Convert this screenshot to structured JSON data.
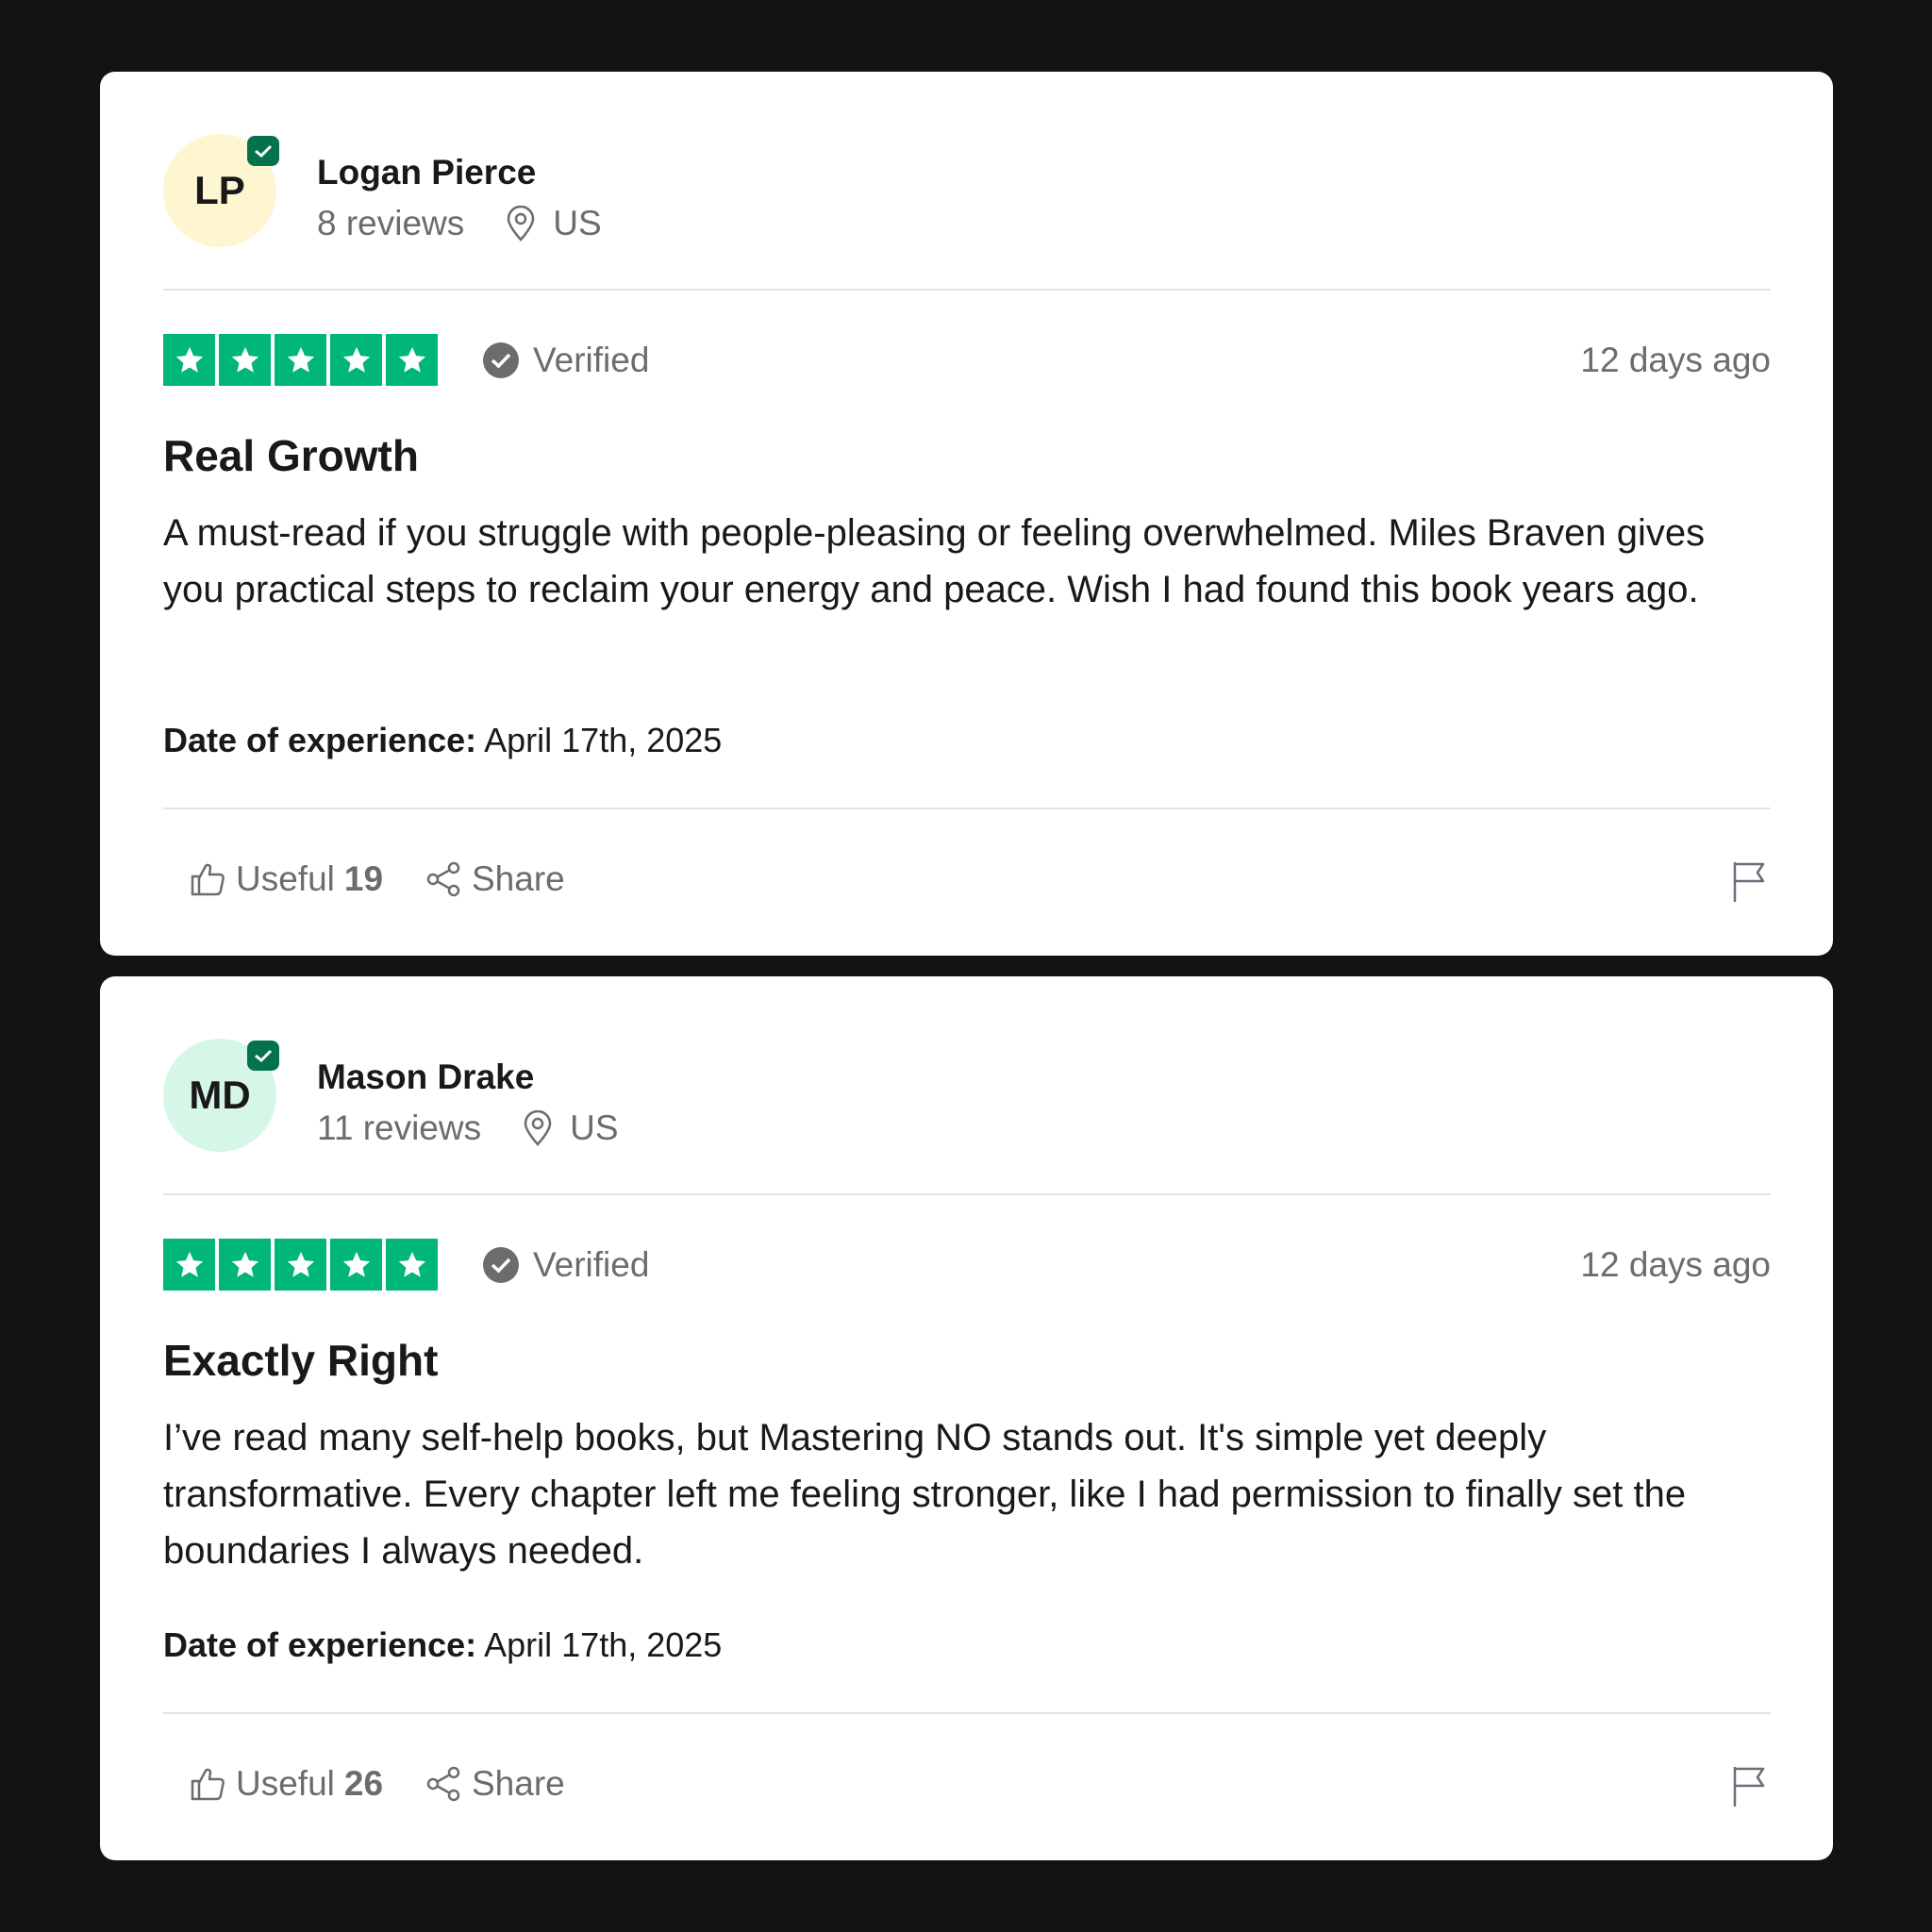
{
  "colors": {
    "background": "#131313",
    "card": "#ffffff",
    "star_green": "#00b67a",
    "badge_green": "#04734d",
    "muted_text": "#6c6c6c"
  },
  "reviews": [
    {
      "avatar": {
        "initials": "LP",
        "bg": "#fdf6d1"
      },
      "reviewer": "Logan Pierce",
      "review_count": "8 reviews",
      "location": "US",
      "rating": 5,
      "verified_label": "Verified",
      "time_ago": "12 days ago",
      "title": "Real Growth",
      "body": "A must-read if you struggle with people-pleasing or feeling overwhelmed. Miles Braven gives you practical steps to reclaim your energy and peace. Wish I had found this book years ago.",
      "experience_label": "Date of experience:",
      "experience_date": "April 17th, 2025",
      "useful_label": "Useful",
      "useful_count": "19",
      "share_label": "Share"
    },
    {
      "avatar": {
        "initials": "MD",
        "bg": "#d6f7e7"
      },
      "reviewer": "Mason Drake",
      "review_count": "11 reviews",
      "location": "US",
      "rating": 5,
      "verified_label": "Verified",
      "time_ago": "12 days ago",
      "title": "Exactly Right",
      "body": "I’ve read many self-help books, but Mastering NO stands out. It's simple yet deeply transformative. Every chapter left me feeling stronger, like I had permission to finally set the boundaries I always needed.",
      "experience_label": "Date of experience:",
      "experience_date": "April 17th, 2025",
      "useful_label": "Useful",
      "useful_count": "26",
      "share_label": "Share"
    }
  ]
}
